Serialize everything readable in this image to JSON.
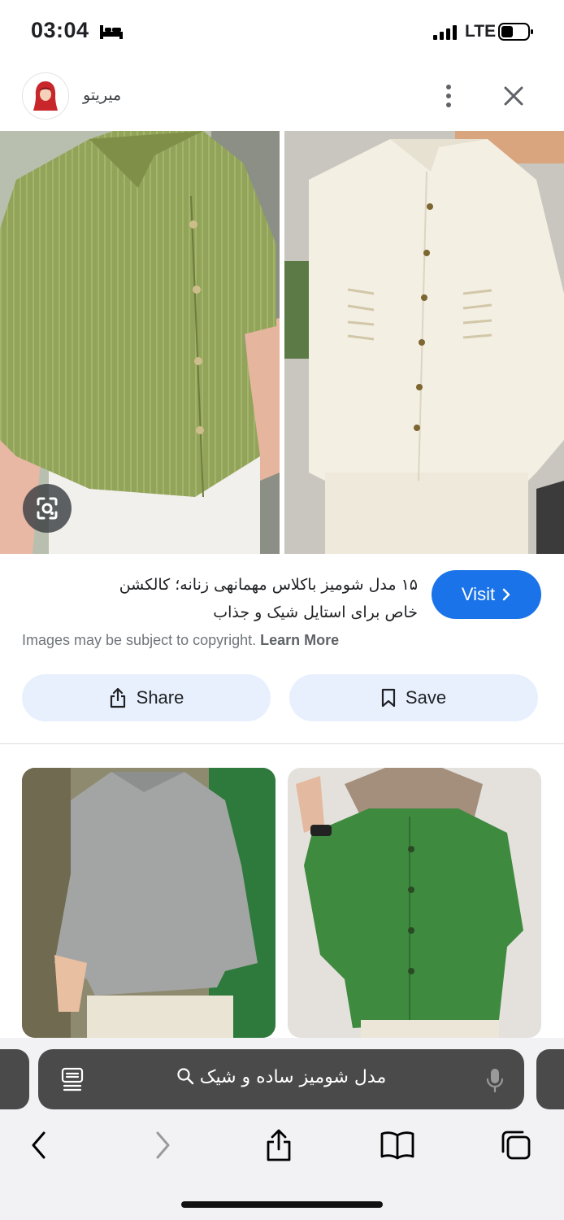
{
  "status_bar": {
    "time": "03:04",
    "network": "LTE"
  },
  "header": {
    "site_name": "میریتو"
  },
  "result": {
    "title_line1": "۱۵ مدل شومیز باکلاس مهمانهی زنانه؛ کالکشن",
    "title_line2": "خاص برای استایل شیک و جذاب",
    "visit_label": "Visit",
    "copyright_text": "Images may be subject to copyright.",
    "learn_more_label": "Learn More",
    "share_label": "Share",
    "save_label": "Save"
  },
  "address_bar": {
    "query": "مدل شومیز ساده و شیک"
  },
  "colors": {
    "visit_blue": "#1a73e8",
    "pill_bg": "#e8f0fe",
    "address_bg": "#4a4a4a"
  },
  "icons": [
    "bed-icon",
    "signal-icon",
    "battery-icon",
    "more-vert-icon",
    "close-icon",
    "lens-icon",
    "chevron-right-icon",
    "share-icon",
    "bookmark-icon",
    "reader-icon",
    "search-icon",
    "mic-icon",
    "back-icon",
    "forward-icon",
    "share-sheet-icon",
    "bookmarks-icon",
    "tabs-icon"
  ]
}
